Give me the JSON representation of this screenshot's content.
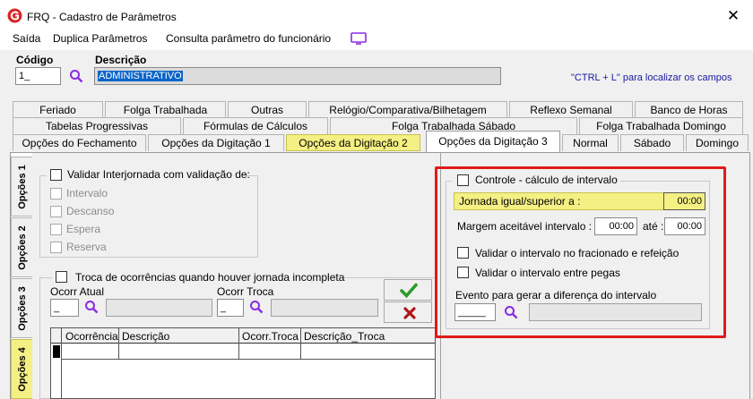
{
  "window": {
    "title": "FRQ - Cadastro de Parâmetros",
    "close": "✕"
  },
  "menu": {
    "saida": "Saída",
    "duplica": "Duplica Parâmetros",
    "consulta": "Consulta parâmetro do funcionário"
  },
  "header": {
    "codigo_label": "Código",
    "codigo_value": "1",
    "descricao_label": "Descrição",
    "descricao_value": "ADMINISTRATIVO",
    "hint": "\"CTRL + L\" para localizar os campos"
  },
  "tabs": {
    "row1": [
      "Feriado",
      "Folga Trabalhada",
      "Outras",
      "Relógio/Comparativa/Bilhetagem",
      "Reflexo Semanal",
      "Banco de Horas"
    ],
    "row2": [
      "Tabelas Progressivas",
      "Fórmulas de Cálculos",
      "Folga Trabalhada Sábado",
      "Folga Trabalhada Domingo"
    ],
    "row3": [
      "Opções do Fechamento",
      "Opções da Digitação 1",
      "Opções da Digitação 2",
      "Opções da Digitação 3",
      "Normal",
      "Sábado",
      "Domingo"
    ]
  },
  "vtabs": [
    "Opções 1",
    "Opções 2",
    "Opções 3",
    "Opções 4"
  ],
  "interjornada": {
    "title": "Validar Interjornada com validação de:",
    "options": [
      "Intervalo",
      "Descanso",
      "Espera",
      "Reserva"
    ]
  },
  "troca": {
    "title": "Troca de ocorrências quando houver jornada incompleta",
    "ocorr_atual_label": "Ocorr Atual",
    "ocorr_troca_label": "Ocorr Troca",
    "columns": [
      "Ocorrência",
      "Descrição",
      "Ocorr.Troca",
      "Descrição_Troca"
    ]
  },
  "controle": {
    "title": "Controle - cálculo de intervalo",
    "jornada_label": "Jornada igual/superior a :",
    "jornada_value": "00:00",
    "margem_label": "Margem aceitável intervalo :",
    "margem_de": "00:00",
    "ate_label": "até :",
    "margem_ate": "00:00",
    "check_fracionado": "Validar o intervalo no fracionado e refeição",
    "check_pegas": "Validar o intervalo entre pegas",
    "evento_label": "Evento para gerar a diferença do intervalo"
  },
  "colors": {
    "highlight": "#f5f084",
    "frame": "#e21a1a",
    "selection": "#0a64c8",
    "brand_red": "#d62828",
    "search": "#8a2be2"
  }
}
